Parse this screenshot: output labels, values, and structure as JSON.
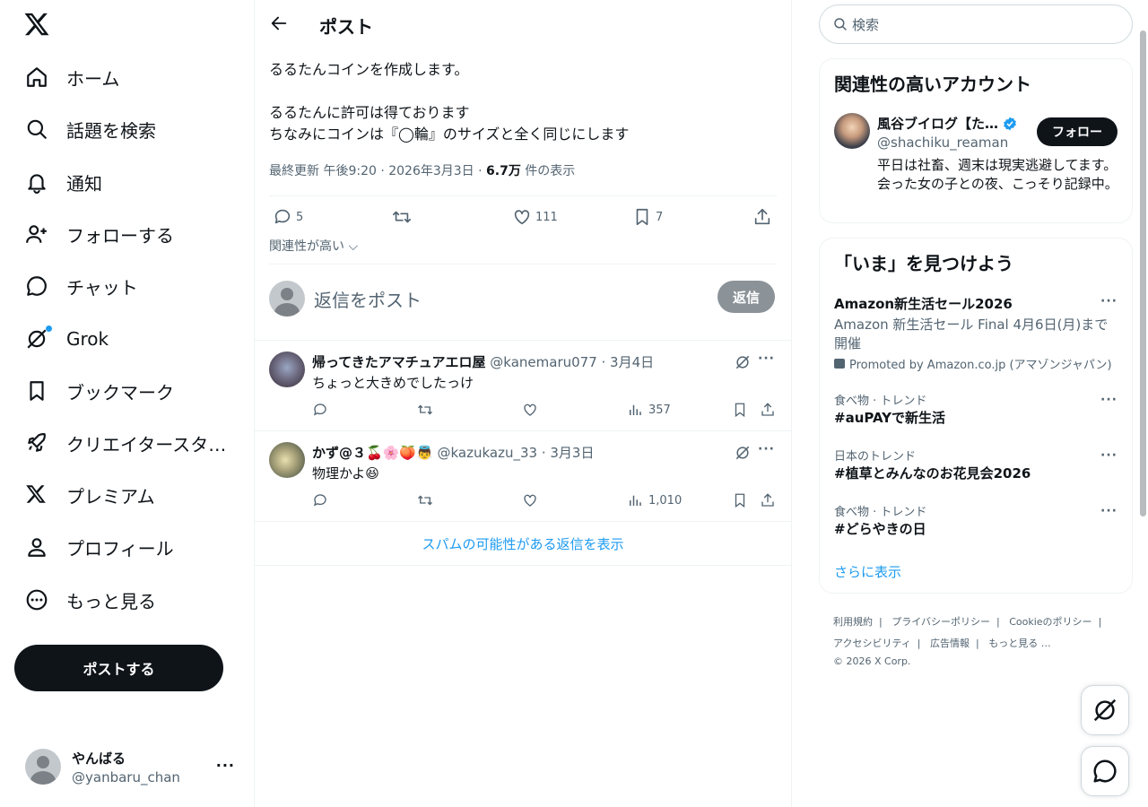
{
  "nav": {
    "items": [
      {
        "label": "ホーム",
        "icon": "home-icon"
      },
      {
        "label": "話題を検索",
        "icon": "search-icon"
      },
      {
        "label": "通知",
        "icon": "bell-icon"
      },
      {
        "label": "フォローする",
        "icon": "person-add-icon"
      },
      {
        "label": "チャット",
        "icon": "chat-icon"
      },
      {
        "label": "Grok",
        "icon": "grok-icon"
      },
      {
        "label": "ブックマーク",
        "icon": "bookmark-icon"
      },
      {
        "label": "クリエイタースタ…",
        "icon": "rocket-icon"
      },
      {
        "label": "プレミアム",
        "icon": "x-logo-icon"
      },
      {
        "label": "プロフィール",
        "icon": "person-icon"
      },
      {
        "label": "もっと見る",
        "icon": "more-circle-icon"
      }
    ],
    "post_button": "ポストする",
    "account": {
      "name": "やんばる",
      "handle": "@yanbaru_chan"
    }
  },
  "main": {
    "title": "ポスト",
    "post": {
      "line1": "るるたんコインを作成します。",
      "line2": "るるたんに許可は得ております",
      "line3": "ちなみにコインは『◯輪』のサイズと全く同じにします",
      "meta_prefix": "最終更新 午後9:20 · 2026年3月3日 · ",
      "views": "6.7万",
      "views_suffix": " 件の表示",
      "replies": "5",
      "likes": "111",
      "bookmarks": "7"
    },
    "relevance": "関連性が高い",
    "reply_placeholder": "返信をポスト",
    "reply_button": "返信",
    "replies": [
      {
        "name": "帰ってきたアマチュアエロ屋",
        "handle": "@kanemaru077 · 3月4日",
        "text": "ちょっと大きめでしたっけ",
        "views": "357"
      },
      {
        "name": "かず@３🍒🌸🍑👼",
        "handle": "@kazukazu_33 · 3月3日",
        "text": "物理かよ😆",
        "views": "1,010"
      }
    ],
    "spam_link": "スパムの可能性がある返信を表示"
  },
  "right": {
    "search_placeholder": "検索",
    "suggest": {
      "title": "関連性の高いアカウント",
      "name": "風谷ブイログ【た…",
      "handle": "@shachiku_reaman",
      "bio": "平日は社畜、週末は現実逃避してます。会った女の子との夜、こっそり記録中。",
      "follow": "フォロー"
    },
    "trends": {
      "title": "「いま」を見つけよう",
      "promo": {
        "title": "Amazon新生活セール2026",
        "desc": "Amazon 新生活セール Final 4月6日(月)まで開催",
        "by": "Promoted by Amazon.co.jp (アマゾンジャパン)"
      },
      "items": [
        {
          "cat": "食べ物 · トレンド",
          "title": "#auPAYで新生活"
        },
        {
          "cat": "日本のトレンド",
          "title": "#植草とみんなのお花見会2026"
        },
        {
          "cat": "食べ物 · トレンド",
          "title": "#どらやきの日"
        }
      ],
      "show_more": "さらに表示"
    },
    "footer": {
      "terms": "利用規約",
      "privacy": "プライバシーポリシー",
      "cookie": "Cookieのポリシー",
      "accessibility": "アクセシビリティ",
      "ads": "広告情報",
      "more": "もっと見る …",
      "copyright": "© 2026 X Corp."
    }
  },
  "colors": {
    "accent": "#1d9bf0",
    "text": "#0f1419",
    "muted": "#536471"
  }
}
